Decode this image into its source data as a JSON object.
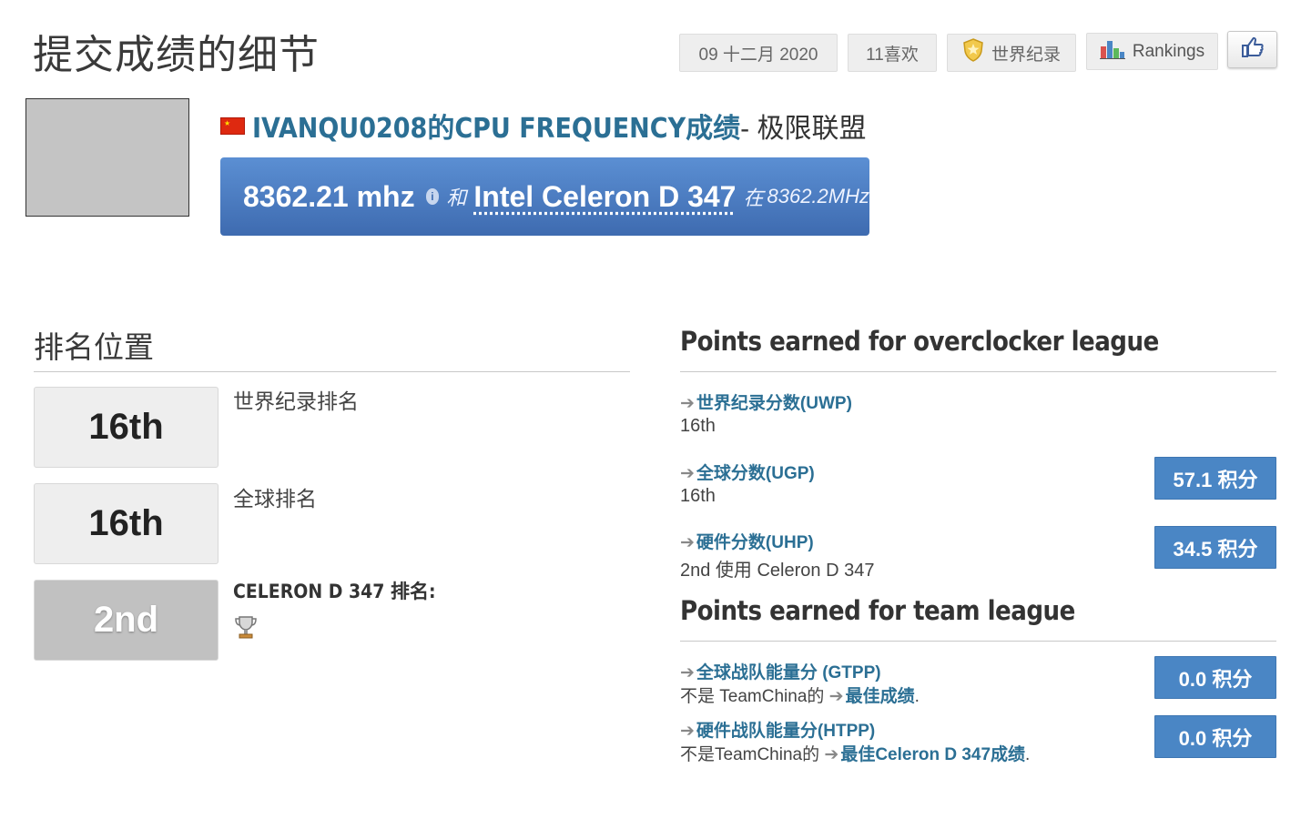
{
  "header": {
    "title": "提交成绩的细节",
    "date": "09 十二月 2020",
    "likes": "11喜欢",
    "world_record": "世界纪录",
    "rankings": "Rankings"
  },
  "submission": {
    "user_title": "IVANQU0208的CPU FREQUENCY成绩",
    "league_suffix": " - 极限联盟",
    "score": "8362.21 mhz",
    "info_glyph": "i",
    "with_word": "和",
    "hardware": "Intel Celeron D 347",
    "at_word": "在",
    "clock": "8362.2MHz"
  },
  "ranking": {
    "heading": "排名位置",
    "items": [
      {
        "value": "16th",
        "label": "世界纪录排名"
      },
      {
        "value": "16th",
        "label": "全球排名"
      },
      {
        "value": "2nd",
        "label": "CELERON D 347 排名:"
      }
    ]
  },
  "points": {
    "overclocker_heading": "Points earned for overclocker league",
    "team_heading": "Points earned for team league",
    "arrow": "➔",
    "uwp": {
      "name": "世界纪录分数(UWP)",
      "value": "16th"
    },
    "ugp": {
      "name": "全球分数(UGP)",
      "value": "16th",
      "points": "57.1 积分"
    },
    "uhp": {
      "name": "硬件分数(UHP)",
      "value": "2nd 使用 Celeron D 347",
      "points": "34.5 积分"
    },
    "gtpp": {
      "name": "全球战队能量分 (GTPP)",
      "prefix": "不是 TeamChina的 ",
      "link": "最佳成绩",
      "points": "0.0 积分"
    },
    "htpp": {
      "name": "硬件战队能量分(HTPP)",
      "prefix": "不是TeamChina的 ",
      "link": "最佳Celeron D 347成绩",
      "points": "0.0 积分"
    },
    "period": "."
  },
  "colors": {
    "accent": "#2b6f94",
    "score_bar": "#4a7ec4",
    "points_button": "#4a86c5"
  }
}
